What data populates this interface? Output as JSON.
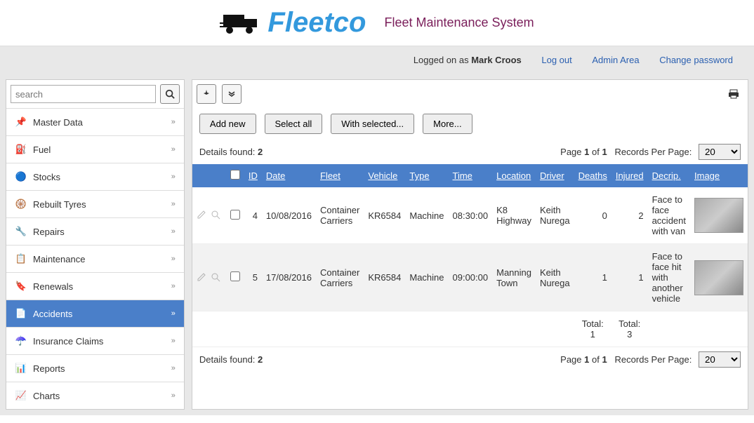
{
  "header": {
    "brand": "Fleetco",
    "tagline": "Fleet Maintenance System"
  },
  "userbar": {
    "logged_prefix": "Logged on as ",
    "username": "Mark Croos",
    "logout": "Log out",
    "admin": "Admin Area",
    "change_pw": "Change password"
  },
  "search": {
    "placeholder": "search"
  },
  "nav": {
    "items": [
      {
        "label": "Master Data"
      },
      {
        "label": "Fuel"
      },
      {
        "label": "Stocks"
      },
      {
        "label": "Rebuilt Tyres"
      },
      {
        "label": "Repairs"
      },
      {
        "label": "Maintenance"
      },
      {
        "label": "Renewals"
      },
      {
        "label": "Accidents"
      },
      {
        "label": "Insurance Claims"
      },
      {
        "label": "Reports"
      },
      {
        "label": "Charts"
      }
    ],
    "active_index": 7
  },
  "actions": {
    "add_new": "Add new",
    "select_all": "Select all",
    "with_selected": "With selected...",
    "more": "More..."
  },
  "list": {
    "details_found_label": "Details found: ",
    "details_found": "2",
    "page_label_pre": "Page ",
    "page_current": "1",
    "page_label_mid": " of ",
    "page_total": "1",
    "records_label": "Records Per Page:",
    "records_value": "20",
    "headers": {
      "id": "ID",
      "date": "Date",
      "fleet": "Fleet",
      "vehicle": "Vehicle",
      "type": "Type",
      "time": "Time",
      "location": "Location",
      "driver": "Driver",
      "deaths": "Deaths",
      "injured": "Injured",
      "descrip": "Decrip.",
      "image": "Image"
    },
    "rows": [
      {
        "id": "4",
        "date": "10/08/2016",
        "fleet": "Container Carriers",
        "vehicle": "KR6584",
        "type": "Machine",
        "time": "08:30:00",
        "location": "K8 Highway",
        "driver": "Keith Nurega",
        "deaths": "0",
        "injured": "2",
        "descrip": "Face to face accident with van"
      },
      {
        "id": "5",
        "date": "17/08/2016",
        "fleet": "Container Carriers",
        "vehicle": "KR6584",
        "type": "Machine",
        "time": "09:00:00",
        "location": "Manning Town",
        "driver": "Keith Nurega",
        "deaths": "1",
        "injured": "1",
        "descrip": "Face to face hit with another vehicle"
      }
    ],
    "totals": {
      "deaths_label": "Total: 1",
      "injured_label": "Total: 3"
    }
  }
}
